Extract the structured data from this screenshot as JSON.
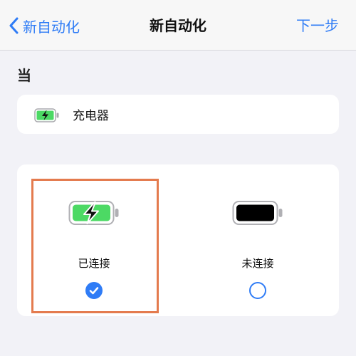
{
  "navbar": {
    "back_label": "新自动化",
    "title": "新自动化",
    "next_label": "下一步"
  },
  "section": {
    "header": "当"
  },
  "trigger": {
    "label": "充电器",
    "icon": "battery-charging-icon"
  },
  "options": [
    {
      "label": "已连接",
      "icon": "battery-charging-icon",
      "selected": true
    },
    {
      "label": "未连接",
      "icon": "battery-full-icon",
      "selected": false
    }
  ],
  "colors": {
    "accent": "#2f7cf6",
    "charging_green": "#4cd964",
    "highlight": "#e47b4e",
    "background": "#f2f2f7",
    "card": "#ffffff"
  }
}
